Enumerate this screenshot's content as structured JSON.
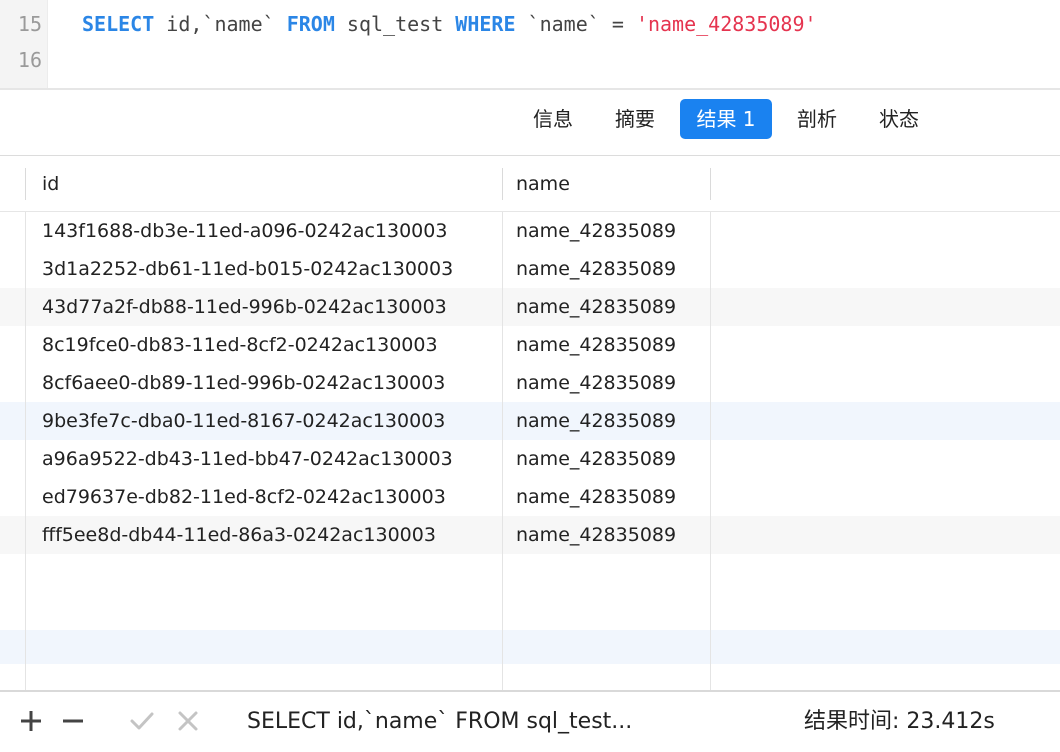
{
  "editor": {
    "line_numbers": [
      "15",
      "16"
    ],
    "code": {
      "kw_select": "SELECT",
      "part_cols": " id,`name` ",
      "kw_from": "FROM",
      "part_table": " sql_test ",
      "kw_where": "WHERE",
      "part_cond": " `name` = ",
      "str_value": "'name_42835089'"
    }
  },
  "tabs": [
    {
      "label": "信息",
      "active": false
    },
    {
      "label": "摘要",
      "active": false
    },
    {
      "label": "结果 1",
      "active": true
    },
    {
      "label": "剖析",
      "active": false
    },
    {
      "label": "状态",
      "active": false
    }
  ],
  "grid": {
    "columns": [
      "id",
      "name"
    ],
    "rows": [
      {
        "id": "143f1688-db3e-11ed-a096-0242ac130003",
        "name": "name_42835089"
      },
      {
        "id": "3d1a2252-db61-11ed-b015-0242ac130003",
        "name": "name_42835089"
      },
      {
        "id": "43d77a2f-db88-11ed-996b-0242ac130003",
        "name": "name_42835089"
      },
      {
        "id": "8c19fce0-db83-11ed-8cf2-0242ac130003",
        "name": "name_42835089"
      },
      {
        "id": "8cf6aee0-db89-11ed-996b-0242ac130003",
        "name": "name_42835089"
      },
      {
        "id": "9be3fe7c-dba0-11ed-8167-0242ac130003",
        "name": "name_42835089"
      },
      {
        "id": "a96a9522-db43-11ed-bb47-0242ac130003",
        "name": "name_42835089"
      },
      {
        "id": "ed79637e-db82-11ed-8cf2-0242ac130003",
        "name": "name_42835089"
      },
      {
        "id": "fff5ee8d-db44-11ed-86a3-0242ac130003",
        "name": "name_42835089"
      }
    ]
  },
  "bottombar": {
    "icons": [
      "plus-icon",
      "minus-icon",
      "check-icon",
      "close-icon"
    ],
    "query_text": "SELECT id,`name` FROM sql_test...",
    "time_text": "结果时间: 23.412s"
  },
  "colors": {
    "keyword": "#2b86e6",
    "string": "#e5344f",
    "accent": "#1a82f0"
  }
}
